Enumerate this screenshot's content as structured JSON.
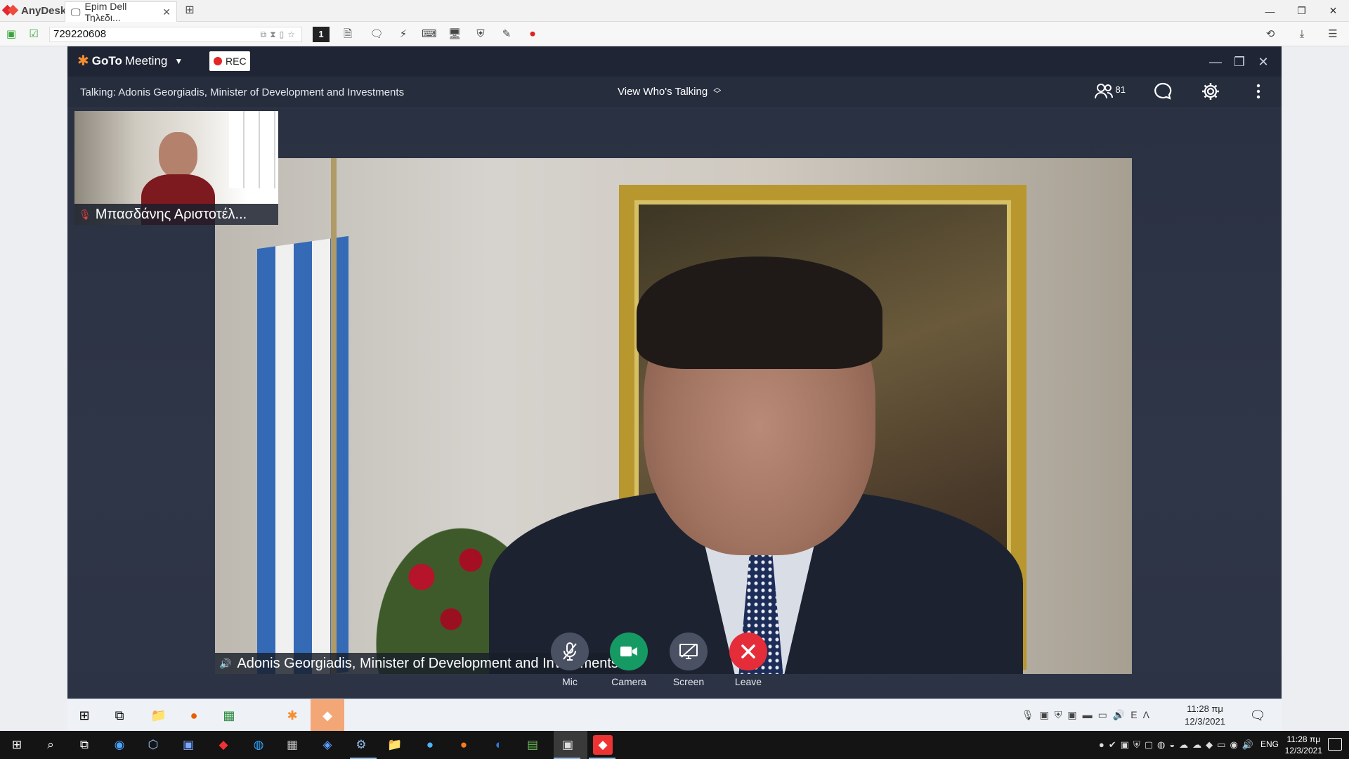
{
  "anydesk": {
    "app_name": "AnyDesk",
    "tab_label": "Epim Dell Τηλεδι...",
    "address": "729220608",
    "session_number": "1"
  },
  "meeting": {
    "logo_goto": "GoTo",
    "logo_meeting": "Meeting",
    "rec_label": "REC",
    "talking_text": "Talking: Adonis Georgiadis, Minister of Development and Investments",
    "view_label": "View Who's Talking",
    "attendee_count": "81",
    "main_speaker_name": "Adonis Georgiadis, Minister of Development and Investments",
    "thumbnail_name": "Μπασδάνης Αριστοτέλ..."
  },
  "controls": {
    "mic": "Mic",
    "camera": "Camera",
    "screen": "Screen",
    "leave": "Leave"
  },
  "remote_clock": {
    "time": "11:28 πμ",
    "date": "12/3/2021",
    "lang": "ΕΛ"
  },
  "local_clock": {
    "time": "11:28 πμ",
    "date": "12/3/2021",
    "lang": "ENG"
  },
  "colors": {
    "gtm_orange": "#f68d2e",
    "camera_green": "#159a63",
    "leave_red": "#e52d3a",
    "rec_red": "#e42525",
    "speaking_green": "#2fd27a"
  }
}
